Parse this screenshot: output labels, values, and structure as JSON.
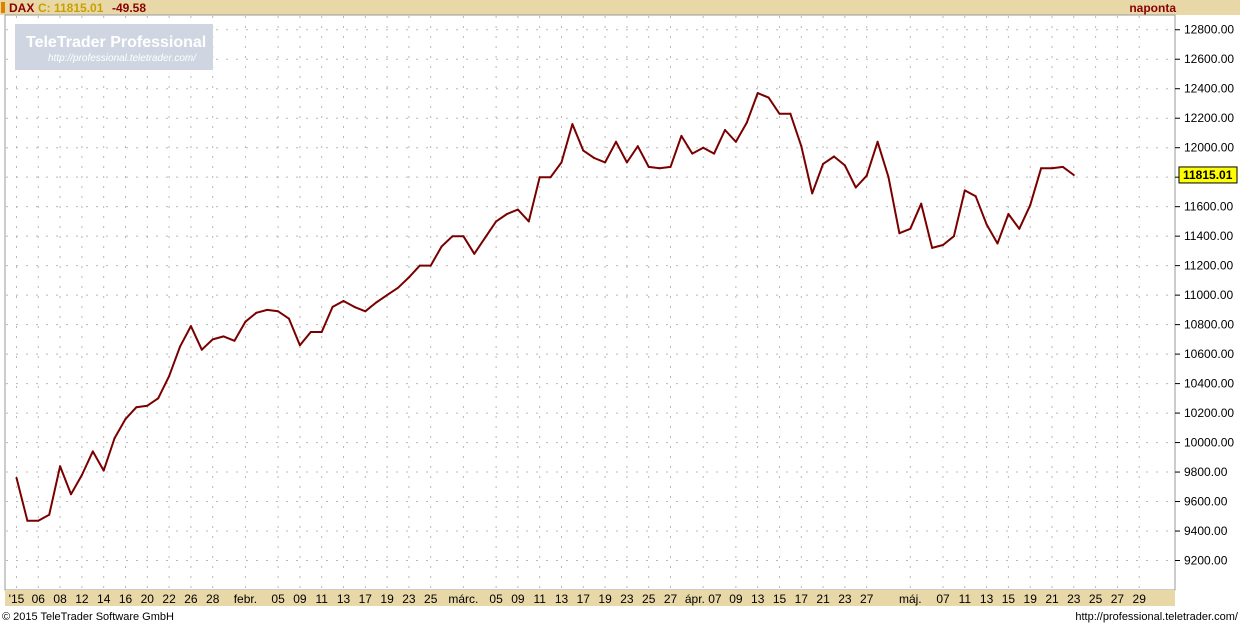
{
  "header": {
    "symbol": "DAX",
    "close_label": "C: 11815.01",
    "change": "-49.58",
    "period": "naponta"
  },
  "logo": {
    "title": "TeleTrader Professional",
    "url": "http://professional.teletrader.com/"
  },
  "footer": {
    "copyright": "© 2015 TeleTrader Software GmbH",
    "url": "http://professional.teletrader.com/"
  },
  "chart_data": {
    "type": "line",
    "series": [
      {
        "values": [
          9760,
          9470,
          9470,
          9510,
          9840,
          9650,
          9780,
          9940,
          9810,
          10030,
          10160,
          10240,
          10250,
          10300,
          10450,
          10650,
          10790,
          10630,
          10700,
          10720,
          10690,
          10820,
          10880,
          10900,
          10890,
          10840,
          10660,
          10750,
          10750,
          10920,
          10960,
          10920,
          10890,
          10950,
          11000,
          11050,
          11120,
          11200,
          11200,
          11330,
          11400,
          11400,
          11280,
          11390,
          11500,
          11550,
          11580,
          11500,
          11800,
          11800,
          11900,
          12160,
          11980,
          11930,
          11900,
          12040,
          11900,
          12010,
          11870,
          11860,
          11870,
          12080,
          11960,
          12000,
          11960,
          12120,
          12040,
          12170,
          12370,
          12340,
          12230,
          12230,
          12010,
          11690,
          11890,
          11940,
          11880,
          11730,
          11810,
          12040,
          11800,
          11420,
          11450,
          11620,
          11320,
          11340,
          11400,
          11710,
          11670,
          11480,
          11350,
          11550,
          11450,
          11610,
          11860,
          11860,
          11870,
          11815.01
        ]
      }
    ],
    "last_value_label": "11815.01",
    "ylim": [
      9000,
      12900
    ],
    "y_ticks": [
      9200,
      9400,
      9600,
      9800,
      10000,
      10200,
      10400,
      10600,
      10800,
      11000,
      11200,
      11400,
      11600,
      11800,
      12000,
      12200,
      12400,
      12600,
      12800
    ],
    "y_tick_labels": [
      "9200.00",
      "9400.00",
      "9600.00",
      "9800.00",
      "10000.00",
      "10200.00",
      "10400.00",
      "10600.00",
      "10800.00",
      "11000.00",
      "11200.00",
      "11400.00",
      "11600.00",
      "11800.00",
      "12000.00",
      "12200.00",
      "12400.00",
      "12600.00",
      "12800.00"
    ],
    "x_ticks": [
      {
        "i": 0,
        "label": "'15"
      },
      {
        "i": 2,
        "label": "06"
      },
      {
        "i": 4,
        "label": "08"
      },
      {
        "i": 6,
        "label": "12"
      },
      {
        "i": 8,
        "label": "14"
      },
      {
        "i": 10,
        "label": "16"
      },
      {
        "i": 12,
        "label": "20"
      },
      {
        "i": 14,
        "label": "22"
      },
      {
        "i": 16,
        "label": "26"
      },
      {
        "i": 18,
        "label": "28"
      },
      {
        "i": 21,
        "label": "febr."
      },
      {
        "i": 24,
        "label": "05"
      },
      {
        "i": 26,
        "label": "09"
      },
      {
        "i": 28,
        "label": "11"
      },
      {
        "i": 30,
        "label": "13"
      },
      {
        "i": 32,
        "label": "17"
      },
      {
        "i": 34,
        "label": "19"
      },
      {
        "i": 36,
        "label": "23"
      },
      {
        "i": 38,
        "label": "25"
      },
      {
        "i": 41,
        "label": "márc."
      },
      {
        "i": 44,
        "label": "05"
      },
      {
        "i": 46,
        "label": "09"
      },
      {
        "i": 48,
        "label": "11"
      },
      {
        "i": 50,
        "label": "13"
      },
      {
        "i": 52,
        "label": "17"
      },
      {
        "i": 54,
        "label": "19"
      },
      {
        "i": 56,
        "label": "23"
      },
      {
        "i": 58,
        "label": "25"
      },
      {
        "i": 60,
        "label": "27"
      },
      {
        "i": 63,
        "label": "ápr. 07"
      },
      {
        "i": 66,
        "label": "09"
      },
      {
        "i": 68,
        "label": "13"
      },
      {
        "i": 70,
        "label": "15"
      },
      {
        "i": 72,
        "label": "17"
      },
      {
        "i": 74,
        "label": "21"
      },
      {
        "i": 76,
        "label": "23"
      },
      {
        "i": 78,
        "label": "27"
      },
      {
        "i": 82,
        "label": "máj."
      },
      {
        "i": 85,
        "label": "07"
      },
      {
        "i": 87,
        "label": "11"
      },
      {
        "i": 89,
        "label": "13"
      },
      {
        "i": 91,
        "label": "15"
      },
      {
        "i": 93,
        "label": "19"
      },
      {
        "i": 95,
        "label": "21"
      },
      {
        "i": 97,
        "label": "23"
      },
      {
        "i": 99,
        "label": "25"
      },
      {
        "i": 101,
        "label": "27"
      },
      {
        "i": 103,
        "label": "29"
      }
    ],
    "grid": true
  }
}
